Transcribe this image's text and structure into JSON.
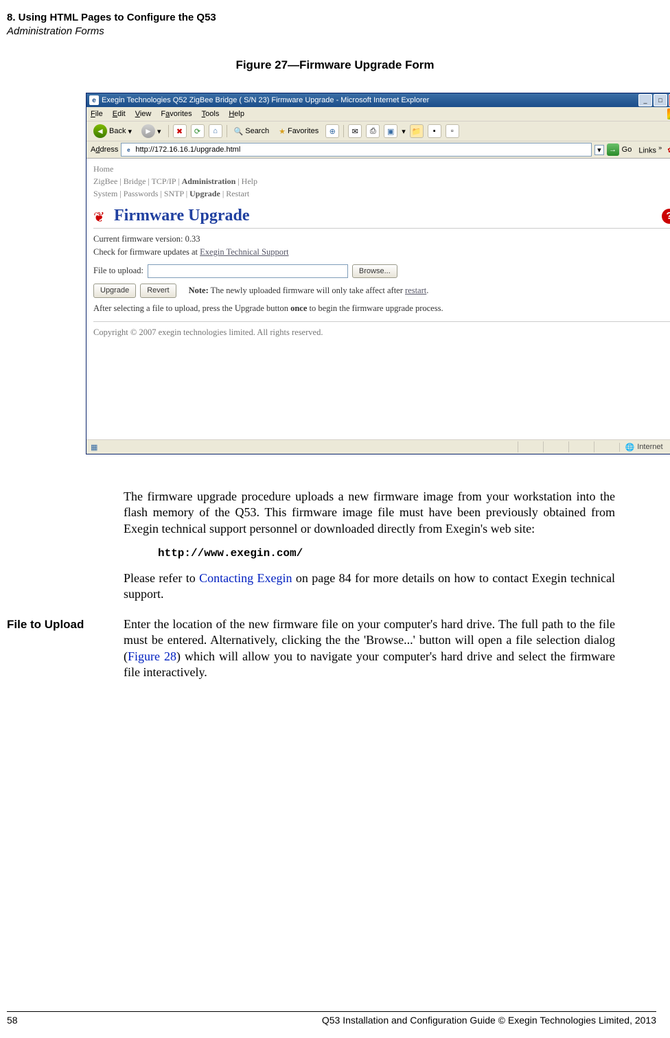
{
  "header": {
    "chapter": "8. Using HTML Pages to Configure the Q53",
    "section": "Administration Forms"
  },
  "figure": {
    "caption": "Figure 27—Firmware Upgrade Form"
  },
  "browser": {
    "title": "Exegin Technologies Q52 ZigBee Bridge ( S/N 23) Firmware Upgrade - Microsoft Internet Explorer",
    "menu": {
      "file": "File",
      "edit": "Edit",
      "view": "View",
      "favorites": "Favorites",
      "tools": "Tools",
      "help": "Help"
    },
    "toolbar": {
      "back": "Back",
      "search": "Search",
      "favorites": "Favorites"
    },
    "address_label": "Address",
    "address_value": "http://172.16.16.1/upgrade.html",
    "go": "Go",
    "links": "Links",
    "nav": {
      "home": "Home",
      "row1_a": "ZigBee",
      "row1_b": "Bridge",
      "row1_c": "TCP/IP",
      "row1_d": "Administration",
      "row1_e": "Help",
      "row2_a": "System",
      "row2_b": "Passwords",
      "row2_c": "SNTP",
      "row2_d": "Upgrade",
      "row2_e": "Restart"
    },
    "page": {
      "heading": "Firmware Upgrade",
      "current_version_label": "Current firmware version: 0.33",
      "check_updates_prefix": "Check for firmware updates at ",
      "check_updates_link": "Exegin Technical Support",
      "file_label": "File to upload:",
      "browse_btn": "Browse...",
      "upgrade_btn": "Upgrade",
      "revert_btn": "Revert",
      "note_label": "Note:",
      "note_text": " The newly uploaded firmware will only take affect after ",
      "note_link": "restart",
      "instruction_prefix": "After selecting a file to upload, press the Upgrade button ",
      "instruction_bold": "once",
      "instruction_suffix": " to begin the firmware upgrade process.",
      "copyright": "Copyright © 2007 exegin technologies limited. All rights reserved."
    },
    "status": {
      "internet": "Internet"
    }
  },
  "body": {
    "p1": "The firmware upgrade procedure uploads a new firmware image from your workstation into the flash memory of the Q53. This firmware image file must have been previously obtained from Exegin technical support personnel or downloaded directly from Exegin's web site:",
    "url": "http://www.exegin.com/",
    "p2_prefix": "Please refer to ",
    "p2_link": "Contacting Exegin",
    "p2_suffix": " on page 84 for more details on how to contact Exegin technical support.",
    "file_heading": "File to Upload",
    "file_body_prefix": "Enter the location of the new firmware file on your computer's hard drive. The full path to the file must be entered. Alternatively, clicking the the 'Browse...' button will open a file selection dialog (",
    "file_body_link": "Figure 28",
    "file_body_suffix": ") which will allow you to navigate your computer's hard drive and select the firmware file interactively."
  },
  "footer": {
    "page": "58",
    "text": "Q53 Installation and Configuration Guide  © Exegin Technologies Limited, 2013"
  }
}
